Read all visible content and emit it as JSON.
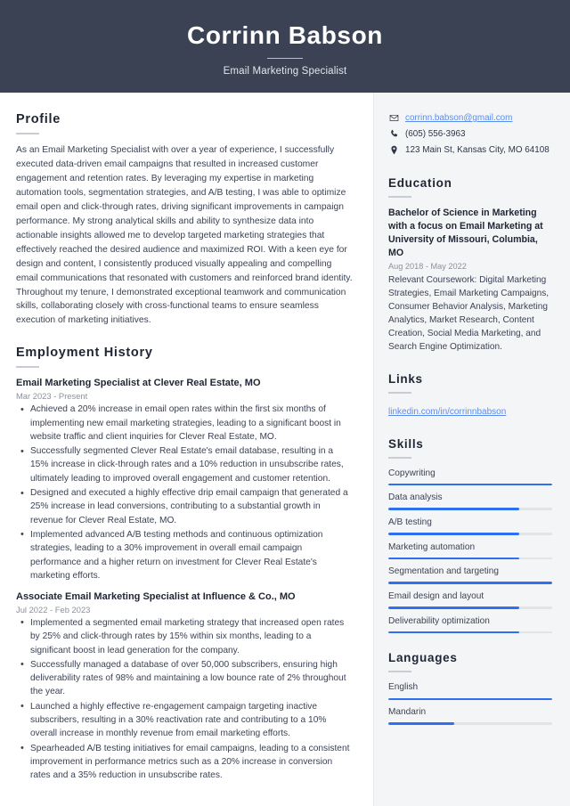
{
  "header": {
    "name": "Corrinn Babson",
    "job_title": "Email Marketing Specialist"
  },
  "colors": {
    "header_bg": "#3b4254",
    "sidebar_bg": "#f4f5f7",
    "accent_bar": "#2f70f0",
    "link": "#5b8def",
    "text": "#3b4254",
    "muted": "#8b909c"
  },
  "main": {
    "profile": {
      "heading": "Profile",
      "text": "As an Email Marketing Specialist with over a year of experience, I successfully executed data-driven email campaigns that resulted in increased customer engagement and retention rates. By leveraging my expertise in marketing automation tools, segmentation strategies, and A/B testing, I was able to optimize email open and click-through rates, driving significant improvements in campaign performance. My strong analytical skills and ability to synthesize data into actionable insights allowed me to develop targeted marketing strategies that effectively reached the desired audience and maximized ROI. With a keen eye for design and content, I consistently produced visually appealing and compelling email communications that resonated with customers and reinforced brand identity. Throughout my tenure, I demonstrated exceptional teamwork and communication skills, collaborating closely with cross-functional teams to ensure seamless execution of marketing initiatives."
    },
    "employment": {
      "heading": "Employment History",
      "jobs": [
        {
          "title": "Email Marketing Specialist at Clever Real Estate, MO",
          "dates": "Mar 2023 - Present",
          "bullets": [
            "Achieved a 20% increase in email open rates within the first six months of implementing new email marketing strategies, leading to a significant boost in website traffic and client inquiries for Clever Real Estate, MO.",
            "Successfully segmented Clever Real Estate's email database, resulting in a 15% increase in click-through rates and a 10% reduction in unsubscribe rates, ultimately leading to improved overall engagement and customer retention.",
            "Designed and executed a highly effective drip email campaign that generated a 25% increase in lead conversions, contributing to a substantial growth in revenue for Clever Real Estate, MO.",
            "Implemented advanced A/B testing methods and continuous optimization strategies, leading to a 30% improvement in overall email campaign performance and a higher return on investment for Clever Real Estate's marketing efforts."
          ]
        },
        {
          "title": "Associate Email Marketing Specialist at Influence & Co., MO",
          "dates": "Jul 2022 - Feb 2023",
          "bullets": [
            "Implemented a segmented email marketing strategy that increased open rates by 25% and click-through rates by 15% within six months, leading to a significant boost in lead generation for the company.",
            "Successfully managed a database of over 50,000 subscribers, ensuring high deliverability rates of 98% and maintaining a low bounce rate of 2% throughout the year.",
            "Launched a highly effective re-engagement campaign targeting inactive subscribers, resulting in a 30% reactivation rate and contributing to a 10% overall increase in monthly revenue from email marketing efforts.",
            "Spearheaded A/B testing initiatives for email campaigns, leading to a consistent improvement in performance metrics such as a 20% increase in conversion rates and a 35% reduction in unsubscribe rates."
          ]
        }
      ]
    }
  },
  "sidebar": {
    "contact": [
      {
        "icon": "email-icon",
        "text": "corrinn.babson@gmail.com",
        "is_link": true
      },
      {
        "icon": "phone-icon",
        "text": "(605) 556-3963",
        "is_link": false
      },
      {
        "icon": "location-pin-icon",
        "text": "123 Main St, Kansas City, MO 64108",
        "is_link": false
      }
    ],
    "education": {
      "heading": "Education",
      "degree": "Bachelor of Science in Marketing with a focus on Email Marketing at University of Missouri, Columbia, MO",
      "dates": "Aug 2018 - May 2022",
      "description": "Relevant Coursework: Digital Marketing Strategies, Email Marketing Campaigns, Consumer Behavior Analysis, Marketing Analytics, Market Research, Content Creation, Social Media Marketing, and Search Engine Optimization."
    },
    "links": {
      "heading": "Links",
      "items": [
        {
          "label": "linkedin.com/in/corrinnbabson"
        }
      ]
    },
    "skills": {
      "heading": "Skills",
      "items": [
        {
          "label": "Copywriting",
          "level": 100
        },
        {
          "label": "Data analysis",
          "level": 80
        },
        {
          "label": "A/B testing",
          "level": 80
        },
        {
          "label": "Marketing automation",
          "level": 80
        },
        {
          "label": "Segmentation and targeting",
          "level": 100
        },
        {
          "label": "Email design and layout",
          "level": 80
        },
        {
          "label": "Deliverability optimization",
          "level": 80
        }
      ]
    },
    "languages": {
      "heading": "Languages",
      "items": [
        {
          "label": "English",
          "level": 100
        },
        {
          "label": "Mandarin",
          "level": 40
        }
      ]
    }
  }
}
